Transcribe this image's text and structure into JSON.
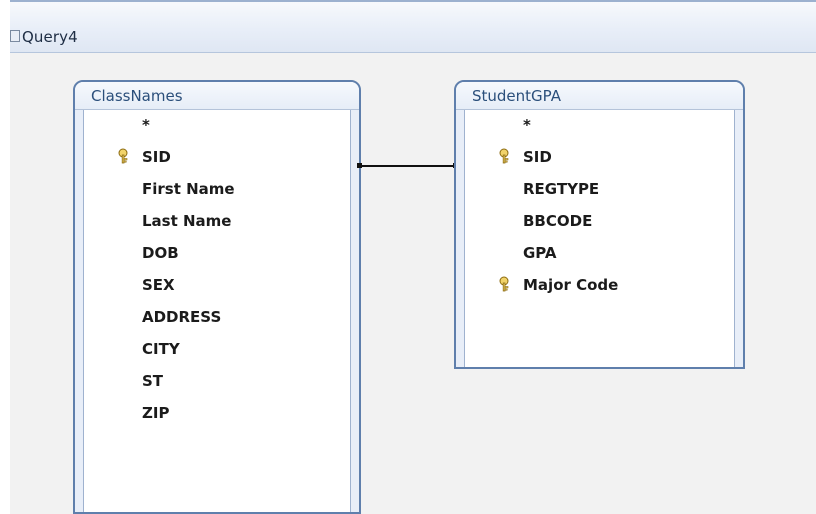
{
  "window": {
    "title": "Query4"
  },
  "tables": [
    {
      "name": "ClassNames",
      "fields": [
        {
          "label": "*",
          "key": false
        },
        {
          "label": "SID",
          "key": true
        },
        {
          "label": "First Name",
          "key": false
        },
        {
          "label": "Last Name",
          "key": false
        },
        {
          "label": "DOB",
          "key": false
        },
        {
          "label": "SEX",
          "key": false
        },
        {
          "label": "ADDRESS",
          "key": false
        },
        {
          "label": "CITY",
          "key": false
        },
        {
          "label": "ST",
          "key": false
        },
        {
          "label": "ZIP",
          "key": false
        }
      ]
    },
    {
      "name": "StudentGPA",
      "fields": [
        {
          "label": "*",
          "key": false
        },
        {
          "label": "SID",
          "key": true
        },
        {
          "label": "REGTYPE",
          "key": false
        },
        {
          "label": "BBCODE",
          "key": false
        },
        {
          "label": "GPA",
          "key": false
        },
        {
          "label": "Major Code",
          "key": true
        }
      ]
    }
  ],
  "colors": {
    "table_border": "#5f7fac",
    "table_title": "#2b4f7b",
    "key_gold": "#c9a227",
    "relationship_line": "#111111"
  },
  "icons": {
    "query": "query-icon",
    "primary_key": "key-icon"
  }
}
